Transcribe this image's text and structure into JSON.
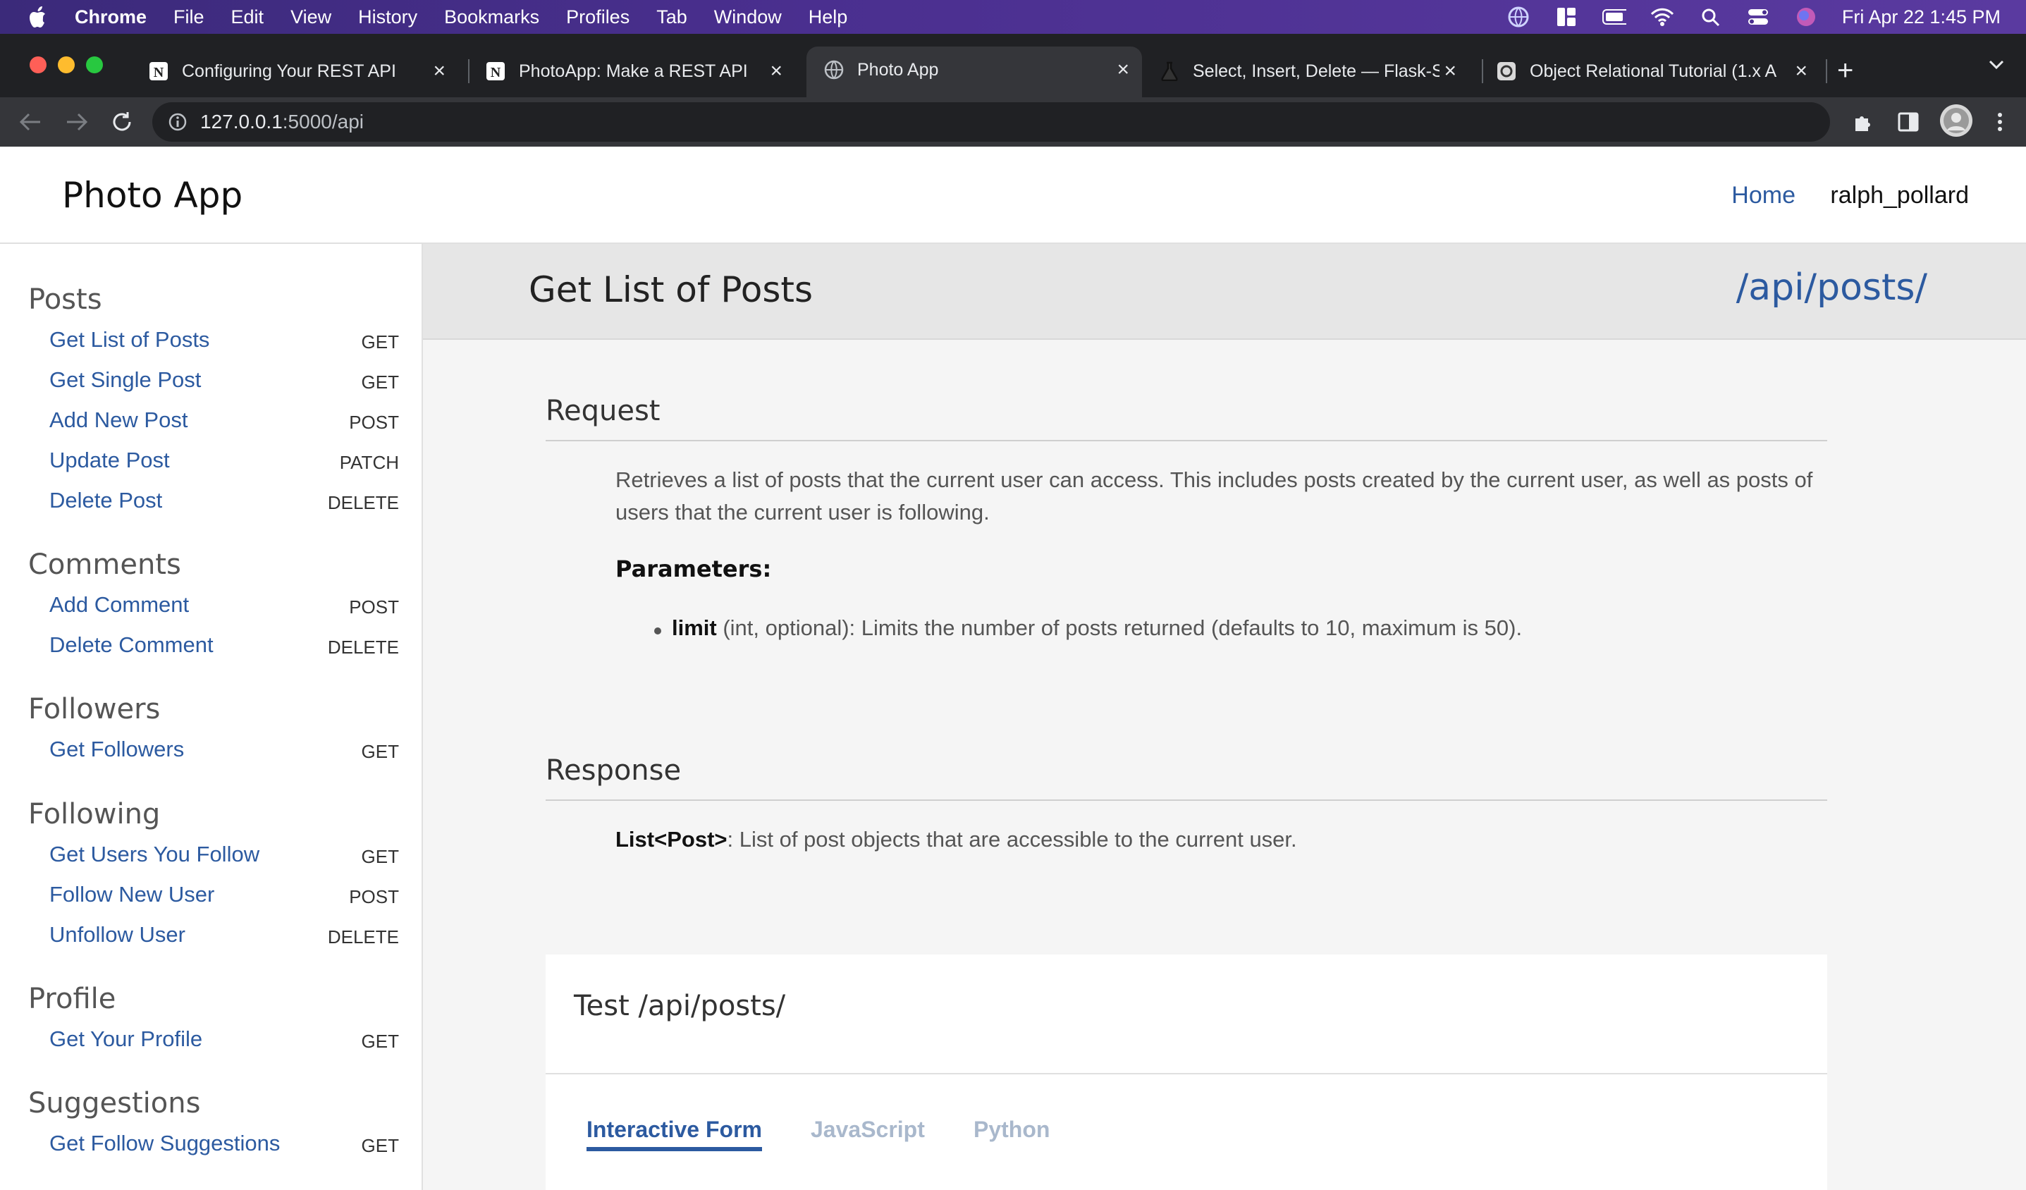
{
  "menubar": {
    "app": "Chrome",
    "items": [
      "File",
      "Edit",
      "View",
      "History",
      "Bookmarks",
      "Profiles",
      "Tab",
      "Window",
      "Help"
    ],
    "clock": "Fri Apr 22  1:45 PM"
  },
  "tabs": [
    {
      "title": "Configuring Your REST API",
      "icon": "notion-icon"
    },
    {
      "title": "PhotoApp: Make a REST API",
      "icon": "notion-icon"
    },
    {
      "title": "Photo App",
      "icon": "globe-icon",
      "active": true
    },
    {
      "title": "Select, Insert, Delete — Flask-S",
      "icon": "flask-icon"
    },
    {
      "title": "Object Relational Tutorial (1.x A",
      "icon": "sqlalchemy-icon"
    }
  ],
  "omnibox": {
    "host": "127.0.0.1",
    "rest": ":5000/api"
  },
  "site": {
    "brand": "Photo App",
    "nav_home": "Home",
    "username": "ralph_pollard"
  },
  "sidebar": {
    "groups": [
      {
        "heading": "Posts",
        "links": [
          {
            "label": "Get List of Posts",
            "method": "GET"
          },
          {
            "label": "Get Single Post",
            "method": "GET"
          },
          {
            "label": "Add New Post",
            "method": "POST"
          },
          {
            "label": "Update Post",
            "method": "PATCH"
          },
          {
            "label": "Delete Post",
            "method": "DELETE"
          }
        ]
      },
      {
        "heading": "Comments",
        "links": [
          {
            "label": "Add Comment",
            "method": "POST"
          },
          {
            "label": "Delete Comment",
            "method": "DELETE"
          }
        ]
      },
      {
        "heading": "Followers",
        "links": [
          {
            "label": "Get Followers",
            "method": "GET"
          }
        ]
      },
      {
        "heading": "Following",
        "links": [
          {
            "label": "Get Users You Follow",
            "method": "GET"
          },
          {
            "label": "Follow New User",
            "method": "POST"
          },
          {
            "label": "Unfollow User",
            "method": "DELETE"
          }
        ]
      },
      {
        "heading": "Profile",
        "links": [
          {
            "label": "Get Your Profile",
            "method": "GET"
          }
        ]
      },
      {
        "heading": "Suggestions",
        "links": [
          {
            "label": "Get Follow Suggestions",
            "method": "GET"
          }
        ]
      }
    ]
  },
  "main": {
    "title": "Get List of Posts",
    "path": "/api/posts/",
    "request_heading": "Request",
    "request_text": "Retrieves a list of posts that the current user can access. This includes posts created by the current user, as well as posts of users that the current user is following.",
    "params_heading": "Parameters:",
    "param_name": "limit",
    "param_desc": " (int, optional): Limits the number of posts returned (defaults to 10, maximum is 50).",
    "response_heading": "Response",
    "response_type": "List<Post>",
    "response_desc": ": List of post objects that are accessible to the current user.",
    "test_title": "Test /api/posts/",
    "test_tabs": [
      "Interactive Form",
      "JavaScript",
      "Python"
    ]
  },
  "colors": {
    "link": "#2c5aa0",
    "tab_inactive": "#a9b8cc",
    "menubar": "#4a2f8f"
  }
}
